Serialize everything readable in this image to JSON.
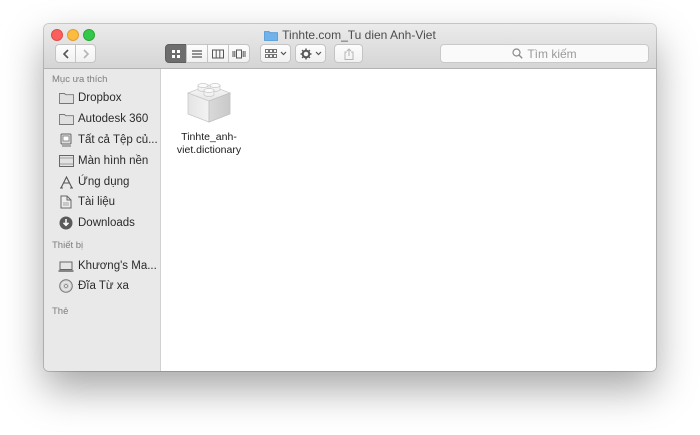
{
  "window": {
    "title": "Tinhte.com_Tu dien Anh-Viet"
  },
  "search": {
    "placeholder": "Tìm kiếm"
  },
  "sidebar": {
    "favorites_header": "Mục ưa thích",
    "favorites": [
      {
        "label": "Dropbox",
        "icon": "folder-icon"
      },
      {
        "label": "Autodesk 360",
        "icon": "folder-icon"
      },
      {
        "label": "Tất cả Tệp củ...",
        "icon": "all-files-icon"
      },
      {
        "label": "Màn hình nền",
        "icon": "desktop-icon"
      },
      {
        "label": "Ứng dụng",
        "icon": "applications-icon"
      },
      {
        "label": "Tài liệu",
        "icon": "documents-icon"
      },
      {
        "label": "Downloads",
        "icon": "downloads-icon"
      }
    ],
    "devices_header": "Thiết bị",
    "devices": [
      {
        "label": "Khương's Ma...",
        "icon": "laptop-icon"
      },
      {
        "label": "Đĩa Từ xa",
        "icon": "remote-disc-icon"
      }
    ],
    "tags_header": "Thẻ"
  },
  "content": {
    "files": [
      {
        "name_line1": "Tinhte_anh-",
        "name_line2": "viet.dictionary",
        "icon": "lego-bundle-icon"
      }
    ]
  }
}
